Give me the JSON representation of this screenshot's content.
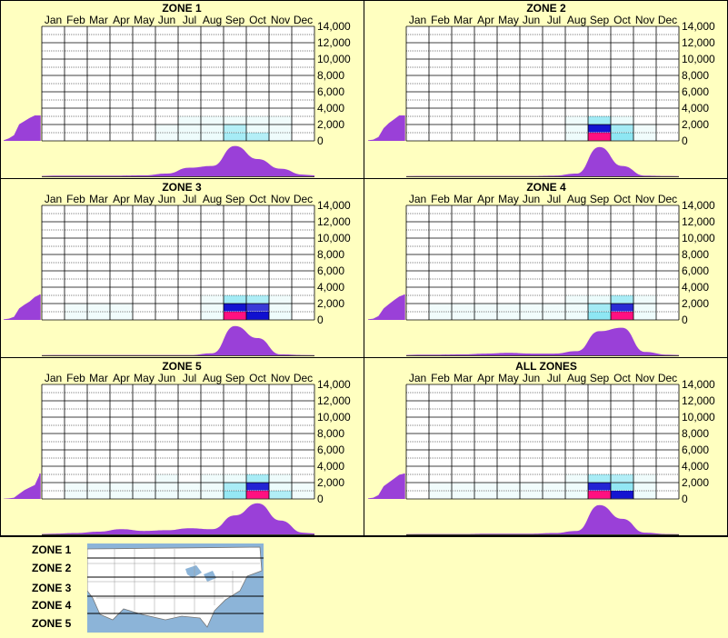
{
  "months": [
    "Jan",
    "Feb",
    "Mar",
    "Apr",
    "May",
    "Jun",
    "Jul",
    "Aug",
    "Sep",
    "Oct",
    "Nov",
    "Dec"
  ],
  "y_ticks": [
    "14,000",
    "12,000",
    "10,000",
    "8,000",
    "6,000",
    "4,000",
    "2,000",
    "0"
  ],
  "colors": {
    "background": "#ffffc0",
    "density": "#9a40d8",
    "heat_low": "#d8f8f8",
    "heat_mid": "#70e0f0",
    "heat_high": "#1010d0",
    "heat_peak": "#ff1080"
  },
  "chart_data": [
    {
      "type": "heatmap",
      "title": "ZONE 1",
      "x_categories": [
        "Jan",
        "Feb",
        "Mar",
        "Apr",
        "May",
        "Jun",
        "Jul",
        "Aug",
        "Sep",
        "Oct",
        "Nov",
        "Dec"
      ],
      "y_range": [
        0,
        14000
      ],
      "grid": true,
      "monthly_intensity": [
        0,
        0,
        0,
        0,
        0,
        0.02,
        0.08,
        0.12,
        0.28,
        0.18,
        0.06,
        0
      ],
      "monthly_density": [
        0.02,
        0.02,
        0.02,
        0.02,
        0.03,
        0.08,
        0.25,
        0.3,
        0.88,
        0.5,
        0.22,
        0.05
      ],
      "elevation_density": [
        0.02,
        0.1,
        0.22,
        0.65,
        0.78,
        0.9,
        1.0,
        1.0
      ]
    },
    {
      "type": "heatmap",
      "title": "ZONE 2",
      "x_categories": [
        "Jan",
        "Feb",
        "Mar",
        "Apr",
        "May",
        "Jun",
        "Jul",
        "Aug",
        "Sep",
        "Oct",
        "Nov",
        "Dec"
      ],
      "y_range": [
        0,
        14000
      ],
      "grid": true,
      "monthly_intensity": [
        0,
        0,
        0,
        0,
        0,
        0,
        0.01,
        0.08,
        1.0,
        0.45,
        0.03,
        0
      ],
      "monthly_density": [
        0.01,
        0.01,
        0.01,
        0.01,
        0.01,
        0.01,
        0.02,
        0.08,
        0.85,
        0.3,
        0.02,
        0.01
      ],
      "elevation_density": [
        0.02,
        0.05,
        0.15,
        0.5,
        0.7,
        0.85,
        1.0,
        1.0
      ]
    },
    {
      "type": "heatmap",
      "title": "ZONE 3",
      "x_categories": [
        "Jan",
        "Feb",
        "Mar",
        "Apr",
        "May",
        "Jun",
        "Jul",
        "Aug",
        "Sep",
        "Oct",
        "Nov",
        "Dec"
      ],
      "y_range": [
        0,
        14000
      ],
      "grid": true,
      "monthly_intensity": [
        0,
        0.02,
        0.02,
        0.02,
        0,
        0,
        0.01,
        0.05,
        1.0,
        0.75,
        0.05,
        0
      ],
      "monthly_density": [
        0.01,
        0.01,
        0.01,
        0.01,
        0.01,
        0.01,
        0.01,
        0.06,
        0.85,
        0.5,
        0.03,
        0.01
      ],
      "elevation_density": [
        0.02,
        0.05,
        0.12,
        0.45,
        0.6,
        0.72,
        0.9,
        1.0
      ]
    },
    {
      "type": "heatmap",
      "title": "ZONE 4",
      "x_categories": [
        "Jan",
        "Feb",
        "Mar",
        "Apr",
        "May",
        "Jun",
        "Jul",
        "Aug",
        "Sep",
        "Oct",
        "Nov",
        "Dec"
      ],
      "y_range": [
        0,
        14000
      ],
      "grid": true,
      "monthly_intensity": [
        0,
        0.02,
        0.02,
        0.02,
        0.02,
        0.02,
        0.02,
        0.05,
        0.45,
        0.85,
        0.1,
        0.01
      ],
      "monthly_density": [
        0.02,
        0.02,
        0.03,
        0.05,
        0.07,
        0.05,
        0.05,
        0.12,
        0.7,
        0.8,
        0.1,
        0.02
      ],
      "elevation_density": [
        0.02,
        0.05,
        0.15,
        0.45,
        0.62,
        0.78,
        0.92,
        1.0
      ]
    },
    {
      "type": "heatmap",
      "title": "ZONE 5",
      "x_categories": [
        "Jan",
        "Feb",
        "Mar",
        "Apr",
        "May",
        "Jun",
        "Jul",
        "Aug",
        "Sep",
        "Oct",
        "Nov",
        "Dec"
      ],
      "y_range": [
        0,
        14000
      ],
      "grid": true,
      "monthly_intensity": [
        0,
        0.02,
        0.02,
        0.02,
        0.02,
        0.05,
        0.03,
        0.05,
        0.4,
        0.9,
        0.2,
        0.02
      ],
      "monthly_density": [
        0.02,
        0.04,
        0.08,
        0.15,
        0.1,
        0.12,
        0.18,
        0.15,
        0.55,
        0.9,
        0.4,
        0.05
      ],
      "elevation_density": [
        0.01,
        0.02,
        0.05,
        0.2,
        0.35,
        0.45,
        0.55,
        1.0
      ]
    },
    {
      "type": "heatmap",
      "title": "ALL ZONES",
      "x_categories": [
        "Jan",
        "Feb",
        "Mar",
        "Apr",
        "May",
        "Jun",
        "Jul",
        "Aug",
        "Sep",
        "Oct",
        "Nov",
        "Dec"
      ],
      "y_range": [
        0,
        14000
      ],
      "grid": true,
      "monthly_intensity": [
        0,
        0.02,
        0.02,
        0.02,
        0.02,
        0.02,
        0.02,
        0.1,
        0.9,
        0.65,
        0.08,
        0.01
      ],
      "monthly_density": [
        0.01,
        0.01,
        0.01,
        0.02,
        0.02,
        0.02,
        0.04,
        0.1,
        0.85,
        0.45,
        0.05,
        0.01
      ],
      "elevation_density": [
        0.02,
        0.05,
        0.15,
        0.5,
        0.65,
        0.8,
        0.95,
        1.0
      ]
    }
  ],
  "legend": {
    "zones": [
      "ZONE 1",
      "ZONE 2",
      "ZONE 3",
      "ZONE 4",
      "ZONE 5"
    ]
  }
}
